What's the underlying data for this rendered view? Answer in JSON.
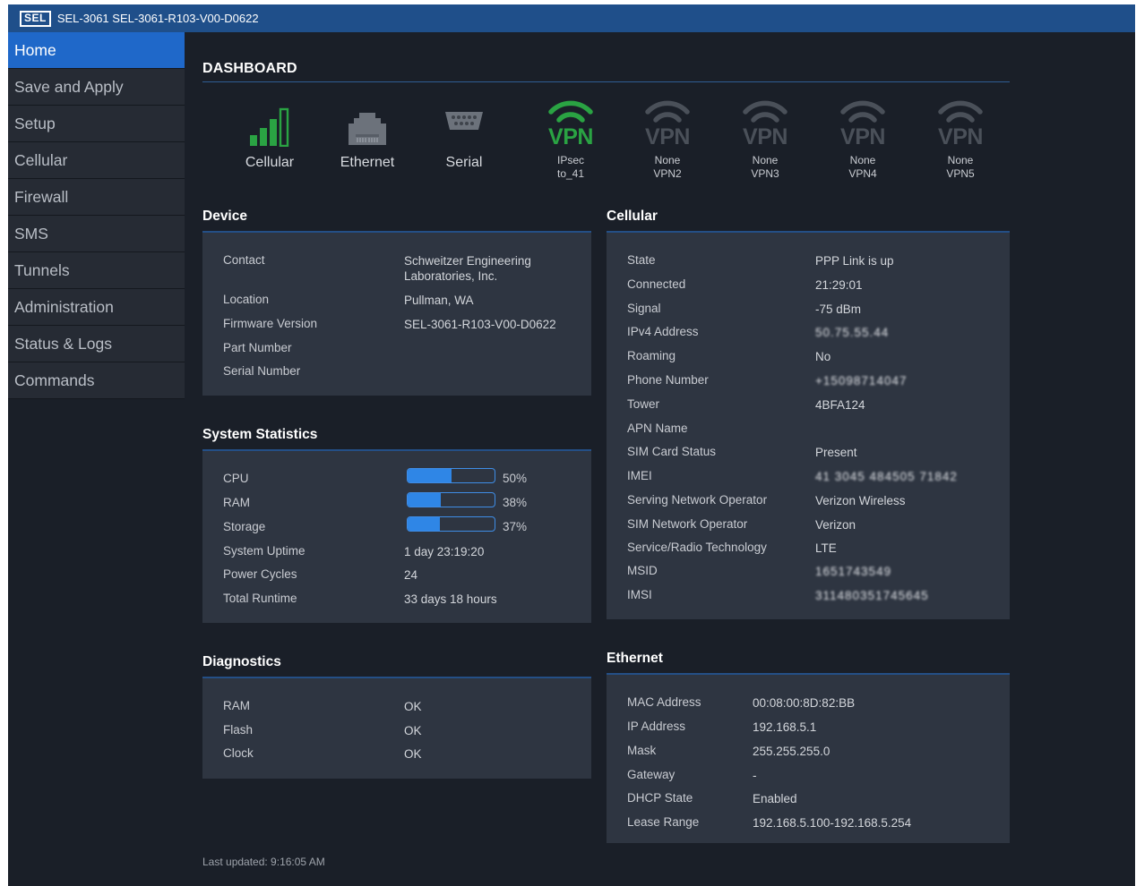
{
  "titlebar": {
    "logo": "SEL",
    "title": "SEL-3061 SEL-3061-R103-V00-D0622"
  },
  "sidebar": {
    "items": [
      {
        "label": "Home",
        "active": true
      },
      {
        "label": "Save and Apply",
        "active": false
      },
      {
        "label": "Setup",
        "active": false
      },
      {
        "label": "Cellular",
        "active": false
      },
      {
        "label": "Firewall",
        "active": false
      },
      {
        "label": "SMS",
        "active": false
      },
      {
        "label": "Tunnels",
        "active": false
      },
      {
        "label": "Administration",
        "active": false
      },
      {
        "label": "Status & Logs",
        "active": false
      },
      {
        "label": "Commands",
        "active": false
      }
    ]
  },
  "dashboard": {
    "title": "DASHBOARD",
    "icons": {
      "cellular": {
        "label": "Cellular",
        "icon": "signal-bars-icon",
        "color": "#2aa343"
      },
      "ethernet": {
        "label": "Ethernet",
        "icon": "ethernet-port-icon",
        "color": "#6c727b"
      },
      "serial": {
        "label": "Serial",
        "icon": "serial-port-icon",
        "color": "#6c727b"
      }
    },
    "vpns": [
      {
        "word": "VPN",
        "line1": "IPsec",
        "line2": "to_41",
        "active": true
      },
      {
        "word": "VPN",
        "line1": "None",
        "line2": "VPN2",
        "active": false
      },
      {
        "word": "VPN",
        "line1": "None",
        "line2": "VPN3",
        "active": false
      },
      {
        "word": "VPN",
        "line1": "None",
        "line2": "VPN4",
        "active": false
      },
      {
        "word": "VPN",
        "line1": "None",
        "line2": "VPN5",
        "active": false
      }
    ],
    "colors": {
      "active": "#2aa343",
      "inactive": "#4a5059",
      "accent": "#1f68c9"
    }
  },
  "device": {
    "title": "Device",
    "contact_label": "Contact",
    "contact_value_1": "Schweitzer Engineering",
    "contact_value_2": "Laboratories, Inc.",
    "location_label": "Location",
    "location_value": "Pullman, WA",
    "firmware_label": "Firmware Version",
    "firmware_value": "SEL-3061-R103-V00-D0622",
    "part_label": "Part Number",
    "serial_label": "Serial Number"
  },
  "system": {
    "title": "System Statistics",
    "cpu_label": "CPU",
    "cpu_pct": "50%",
    "cpu_fraction": 0.5,
    "ram_label": "RAM",
    "ram_pct": "38%",
    "ram_fraction": 0.38,
    "storage_label": "Storage",
    "storage_pct": "37%",
    "storage_fraction": 0.37,
    "uptime_label": "System Uptime",
    "uptime_value": "1 day 23:19:20",
    "power_label": "Power Cycles",
    "power_value": "24",
    "runtime_label": "Total Runtime",
    "runtime_value": "33 days 18 hours"
  },
  "diagnostics": {
    "title": "Diagnostics",
    "rows": [
      {
        "label": "RAM",
        "value": "OK"
      },
      {
        "label": "Flash",
        "value": "OK"
      },
      {
        "label": "Clock",
        "value": "OK"
      }
    ]
  },
  "cellular": {
    "title": "Cellular",
    "rows": [
      {
        "label": "State",
        "value": "PPP Link is up",
        "redacted": false
      },
      {
        "label": "Connected",
        "value": "21:29:01",
        "redacted": false
      },
      {
        "label": "Signal",
        "value": "-75 dBm",
        "redacted": false
      },
      {
        "label": "IPv4 Address",
        "value": "50.75.55.44",
        "redacted": true
      },
      {
        "label": "Roaming",
        "value": "No",
        "redacted": false
      },
      {
        "label": "Phone Number",
        "value": "+15098714047",
        "redacted": true
      },
      {
        "label": "Tower",
        "value": "4BFA124",
        "redacted": false
      },
      {
        "label": "APN Name",
        "value": "",
        "redacted": false
      },
      {
        "label": "SIM Card Status",
        "value": "Present",
        "redacted": false
      },
      {
        "label": "IMEI",
        "value": "41 3045 484505 71842",
        "redacted": true
      },
      {
        "label": "Serving Network Operator",
        "value": "Verizon Wireless",
        "redacted": false
      },
      {
        "label": "SIM Network Operator",
        "value": "Verizon",
        "redacted": false
      },
      {
        "label": "Service/Radio Technology",
        "value": "LTE",
        "redacted": false
      },
      {
        "label": "MSID",
        "value": "1651743549",
        "redacted": true
      },
      {
        "label": "IMSI",
        "value": "311480351745645",
        "redacted": true
      }
    ]
  },
  "ethernet": {
    "title": "Ethernet",
    "rows": [
      {
        "label": "MAC Address",
        "value": "00:08:00:8D:82:BB"
      },
      {
        "label": "IP Address",
        "value": "192.168.5.1"
      },
      {
        "label": "Mask",
        "value": "255.255.255.0"
      },
      {
        "label": "Gateway",
        "value": "-"
      },
      {
        "label": "DHCP State",
        "value": "Enabled"
      },
      {
        "label": "Lease Range",
        "value": "192.168.5.100-192.168.5.254"
      }
    ]
  },
  "footer": {
    "text": "Last updated: 9:16:05 AM"
  }
}
